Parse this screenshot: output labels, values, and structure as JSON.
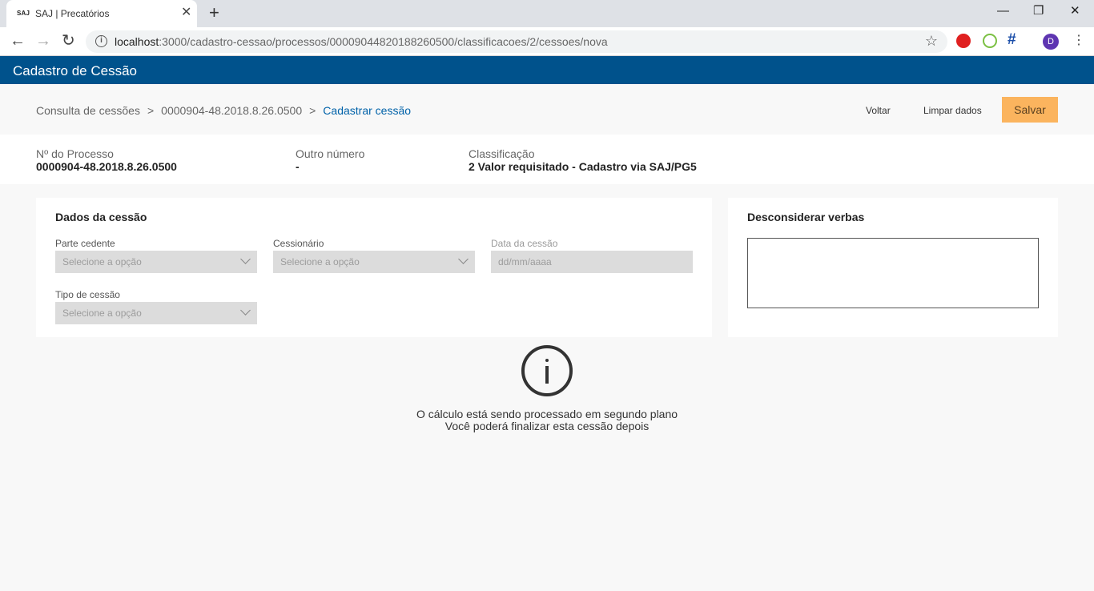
{
  "browser": {
    "tab_favicon": "SAJ",
    "tab_title": "SAJ | Precatórios",
    "url_host": "localhost",
    "url_path": ":3000/cadastro-cessao/processos/00009044820188260500/classificacoes/2/cessoes/nova",
    "profile_initial": "D"
  },
  "app": {
    "title": "Cadastro de Cessão",
    "header_color": "#00528c"
  },
  "breadcrumb": {
    "items": [
      "Consulta de cessões",
      "0000904-48.2018.8.26.0500"
    ],
    "current": "Cadastrar cessão",
    "separator": ">"
  },
  "actions": {
    "back": "Voltar",
    "clear": "Limpar dados",
    "save": "Salvar",
    "save_color": "#fbb45e"
  },
  "info": {
    "processo_label": "Nº do Processo",
    "processo_value": "0000904-48.2018.8.26.0500",
    "outro_label": "Outro número",
    "outro_value": "-",
    "classificacao_label": "Classificação",
    "classificacao_value": "2 Valor requisitado - Cadastro via SAJ/PG5"
  },
  "dados_cessao": {
    "title": "Dados da cessão",
    "parte_cedente": {
      "label": "Parte cedente",
      "placeholder": "Selecione a opção"
    },
    "cessionario": {
      "label": "Cessionário",
      "placeholder": "Selecione a opção"
    },
    "data_cessao": {
      "label": "Data da cessão",
      "placeholder": "dd/mm/aaaa"
    },
    "tipo_cessao": {
      "label": "Tipo de cessão",
      "placeholder": "Selecione a opção"
    }
  },
  "verbas": {
    "title": "Desconsiderar verbas"
  },
  "notice": {
    "icon": "info-icon",
    "line1": "O cálculo está sendo processado em segundo plano",
    "line2": "Você poderá finalizar esta cessão depois"
  }
}
